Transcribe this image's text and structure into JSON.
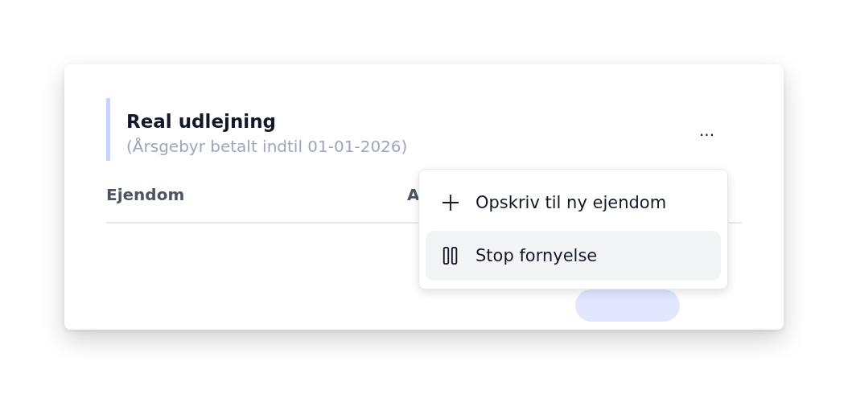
{
  "card": {
    "title": "Real udlejning",
    "subtitle": "(Årsgebyr betalt indtil 01-01-2026)",
    "more_button": "...",
    "table": {
      "columns": [
        "Ejendom",
        "A"
      ]
    }
  },
  "menu": {
    "items": [
      {
        "kind": "add",
        "label": "Opskriv til ny ejendom",
        "highlighted": false
      },
      {
        "kind": "pause",
        "label": "Stop fornyelse",
        "highlighted": true
      }
    ]
  }
}
